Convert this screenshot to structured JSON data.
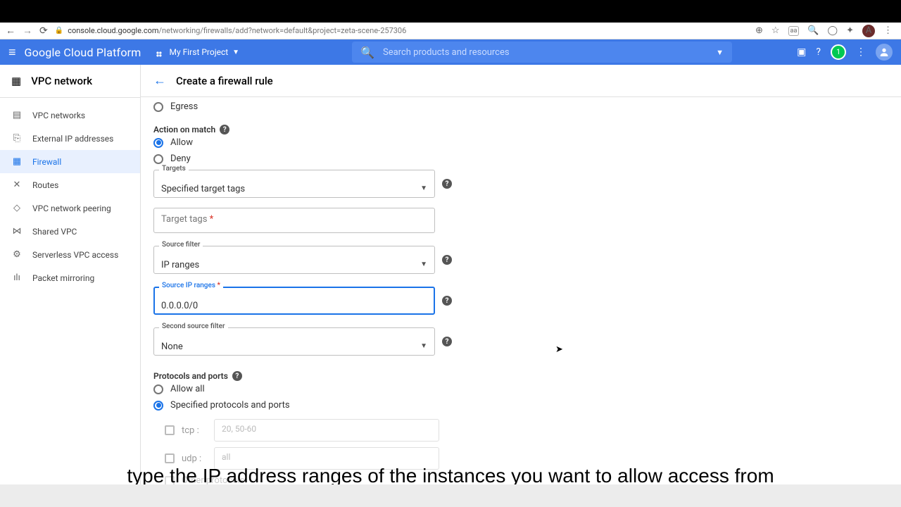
{
  "browser": {
    "url_domain": "console.cloud.google.com",
    "url_path": "/networking/firewalls/add?network=default&project=zeta-scene-257306",
    "avatar_letter": "A"
  },
  "header": {
    "logo": "Google Cloud Platform",
    "project": "My First Project",
    "search_placeholder": "Search products and resources",
    "notif_count": "1"
  },
  "sidebar": {
    "title": "VPC network",
    "items": [
      {
        "label": "VPC networks"
      },
      {
        "label": "External IP addresses"
      },
      {
        "label": "Firewall"
      },
      {
        "label": "Routes"
      },
      {
        "label": "VPC network peering"
      },
      {
        "label": "Shared VPC"
      },
      {
        "label": "Serverless VPC access"
      },
      {
        "label": "Packet mirroring"
      }
    ]
  },
  "page": {
    "title": "Create a firewall rule",
    "direction_option": "Egress",
    "action_label": "Action on match",
    "action_allow": "Allow",
    "action_deny": "Deny",
    "targets_label": "Targets",
    "targets_value": "Specified target tags",
    "target_tags_label": "Target tags",
    "source_filter_label": "Source filter",
    "source_filter_value": "IP ranges",
    "source_ip_label": "Source IP ranges",
    "source_ip_value": "0.0.0.0/0",
    "second_filter_label": "Second source filter",
    "second_filter_value": "None",
    "protocols_label": "Protocols and ports",
    "proto_allow_all": "Allow all",
    "proto_specified": "Specified protocols and ports",
    "tcp_label": "tcp :",
    "tcp_placeholder": "20, 50-60",
    "udp_label": "udp :",
    "udp_placeholder": "all",
    "other_label": "Other protocols"
  },
  "caption": "type the IP address ranges of the instances you want to allow access from"
}
